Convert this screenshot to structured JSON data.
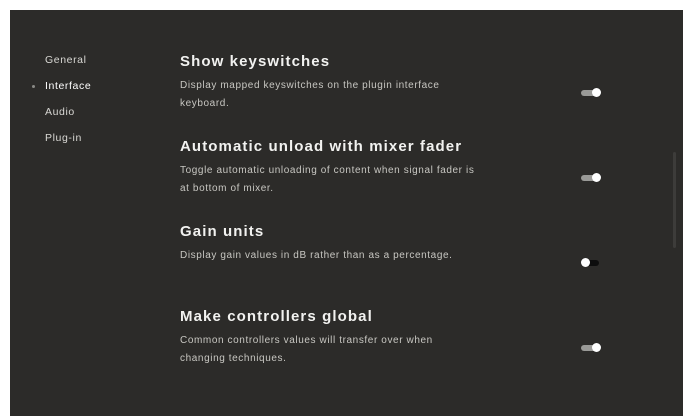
{
  "sidebar": {
    "items": [
      {
        "label": "General",
        "active": false
      },
      {
        "label": "Interface",
        "active": true
      },
      {
        "label": "Audio",
        "active": false
      },
      {
        "label": "Plug-in",
        "active": false
      }
    ]
  },
  "settings": [
    {
      "title": "Show keyswitches",
      "description": "Display mapped keyswitches on the plugin interface keyboard.",
      "enabled": true
    },
    {
      "title": "Automatic unload with mixer fader",
      "description": "Toggle automatic unloading of content when signal fader is at bottom of mixer.",
      "enabled": true
    },
    {
      "title": "Gain units",
      "description": "Display gain values in dB rather than as a percentage.",
      "enabled": false
    },
    {
      "title": "Make controllers global",
      "description": "Common controllers values will transfer over when changing techniques.",
      "enabled": true
    }
  ],
  "colors": {
    "background": "#2c2b29",
    "text": "#ffffff",
    "toggle_on_track": "#9a9a97",
    "toggle_off_track": "#0d0d0d"
  }
}
